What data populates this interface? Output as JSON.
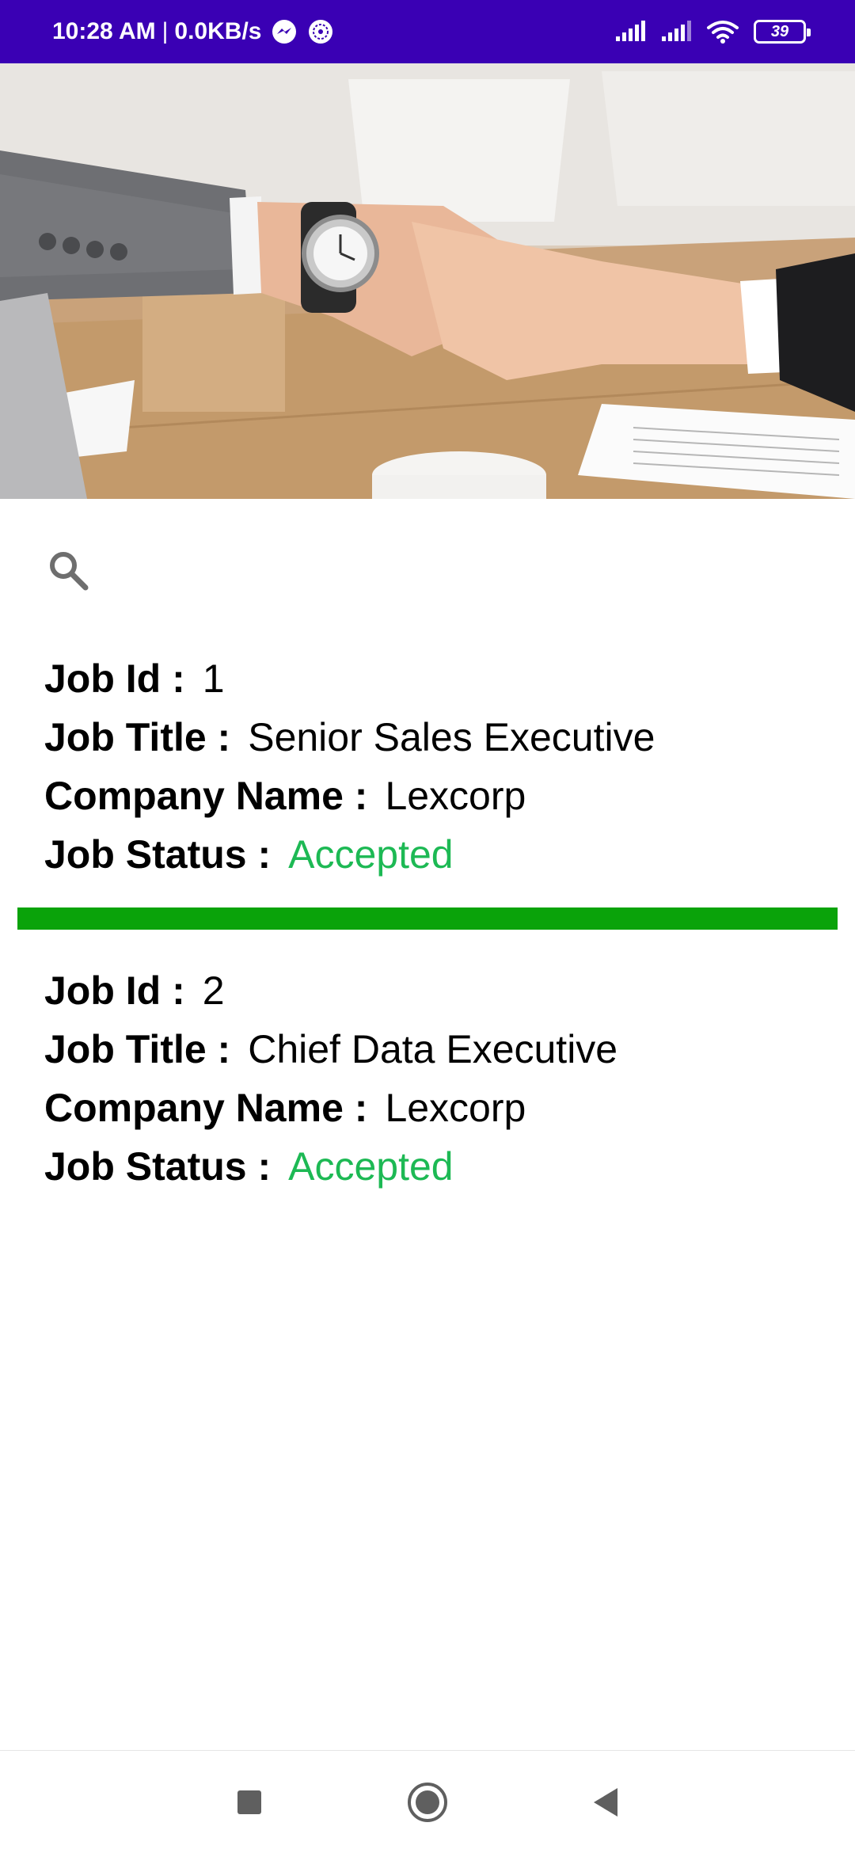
{
  "status_bar": {
    "time": "10:28 AM",
    "separator": "|",
    "network_speed": "0.0KB/s",
    "battery_level": "39",
    "icons": [
      "messenger-icon",
      "app-notification-icon",
      "signal-icon",
      "signal-icon",
      "wifi-icon",
      "battery-icon"
    ],
    "background_color": "#3a00b4"
  },
  "hero": {
    "image": "handshake-photo"
  },
  "search": {
    "icon": "search-icon"
  },
  "jobs": [
    {
      "id_label": "Job Id :",
      "id_value": "1",
      "title_label": "Job Title :",
      "title_value": "Senior Sales Executive",
      "company_label": "Company Name :",
      "company_value": "Lexcorp",
      "status_label": "Job Status :",
      "status_value": "Accepted"
    },
    {
      "id_label": "Job Id :",
      "id_value": "2",
      "title_label": "Job Title :",
      "title_value": "Chief Data Executive",
      "company_label": "Company Name :",
      "company_value": "Lexcorp",
      "status_label": "Job Status :",
      "status_value": "Accepted"
    }
  ],
  "colors": {
    "status_accepted": "#1db954",
    "divider": "#0aa30a"
  },
  "nav_bar": {
    "buttons": [
      "recents-button",
      "home-button",
      "back-button"
    ]
  }
}
